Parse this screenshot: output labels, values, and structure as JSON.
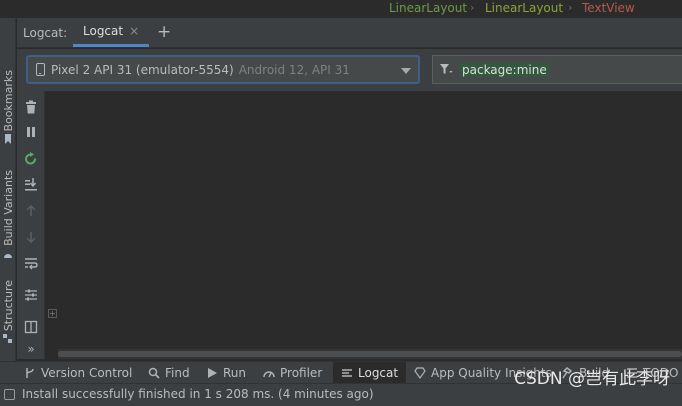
{
  "breadcrumb": {
    "items": [
      {
        "label": "LinearLayout",
        "color": "#6a9c46"
      },
      {
        "label": "LinearLayout",
        "color": "#8aa33b"
      },
      {
        "label": "TextView",
        "color": "#b55a4c"
      }
    ]
  },
  "left_stripe": {
    "tabs": [
      "Bookmarks",
      "Build Variants",
      "Structure"
    ]
  },
  "tool_window": {
    "title": "Logcat:",
    "tab_label": "Logcat",
    "tab_close": "×",
    "add_tab": "+"
  },
  "filter_row": {
    "device_name": "Pixel 2 API 31 (emulator-5554)",
    "device_os": "Android 12, API 31",
    "filter_query": "package:mine"
  },
  "toolbar": {
    "icons": [
      "trash-icon",
      "pause-icon",
      "restart-icon",
      "scroll-to-end-icon",
      "up-icon",
      "down-icon",
      "soft-wrap-icon",
      "settings-icon",
      "layout-icon",
      "more-icon"
    ],
    "more_label": "»"
  },
  "bottom_bar": {
    "items": [
      {
        "label": "Version Control",
        "icon": "branch-icon"
      },
      {
        "label": "Find",
        "icon": "search-icon"
      },
      {
        "label": "Run",
        "icon": "run-icon"
      },
      {
        "label": "Profiler",
        "icon": "gauge-icon"
      },
      {
        "label": "Logcat",
        "icon": "logcat-icon",
        "active": true
      },
      {
        "label": "App Quality Insights",
        "icon": "diamond-icon"
      },
      {
        "label": "Build",
        "icon": "hammer-icon"
      },
      {
        "label": "TODO",
        "icon": "list-icon"
      }
    ]
  },
  "status_bar": {
    "message": "Install successfully finished in 1 s 208 ms. (4 minutes ago)"
  },
  "watermark": "CSDN @岂有此李呀",
  "colors": {
    "accent": "#4a88c7",
    "filter_highlight": "#32593d",
    "panel": "#3c3f41",
    "editor": "#2b2b2b"
  }
}
